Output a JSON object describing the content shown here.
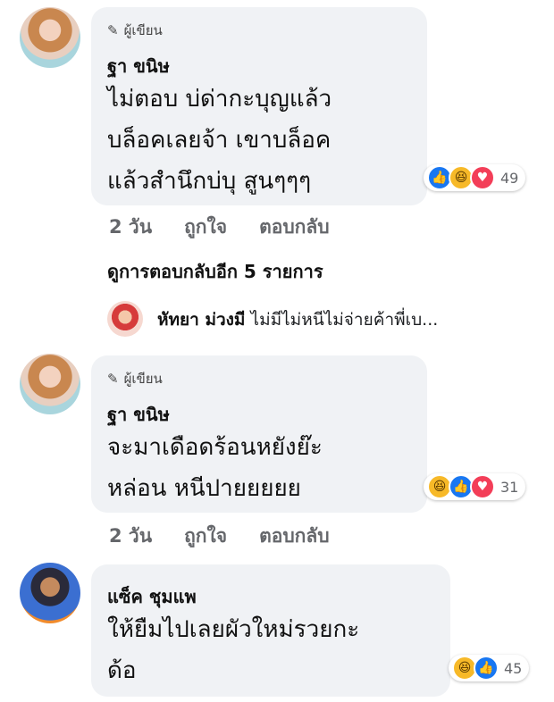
{
  "comments": [
    {
      "badge": "ผู้เขียน",
      "author": "ฐา ขนิษ",
      "lines": [
        "ไม่ตอบ บ่ด่ากะบุญแล้ว",
        "บล็อคเลยจ้า เขาบล็อค",
        "แล้วสำนึกบ่บุ สูนๆๆๆ"
      ],
      "time": "2 วัน",
      "like": "ถูกใจ",
      "reply": "ตอบกลับ",
      "reaction_icons": [
        "like-icon",
        "haha-icon",
        "love-icon"
      ],
      "reaction_count": "49"
    },
    {
      "badge": "ผู้เขียน",
      "author": "ฐา ขนิษ",
      "lines": [
        "จะมาเดือดร้อนหยังย๊ะ",
        "หล่อน หนีปายยยยย"
      ],
      "time": "2 วัน",
      "like": "ถูกใจ",
      "reply": "ตอบกลับ",
      "reaction_icons": [
        "haha-icon",
        "like-icon",
        "love-icon"
      ],
      "reaction_count": "31"
    },
    {
      "author": "แซ็ค ชุมแพ",
      "lines": [
        "ให้ยืมไปเลยผัวใหม่รวยกะ",
        "ด้อ"
      ],
      "reaction_icons": [
        "haha-icon",
        "like-icon"
      ],
      "reaction_count": "45"
    }
  ],
  "more_replies": "ดูการตอบกลับอีก 5 รายการ",
  "reply_preview": {
    "author": "หัทยา ม่วงมี",
    "text": "ไม่มีไม่หนีไม่จ่ายค้าพี่เบ..."
  }
}
